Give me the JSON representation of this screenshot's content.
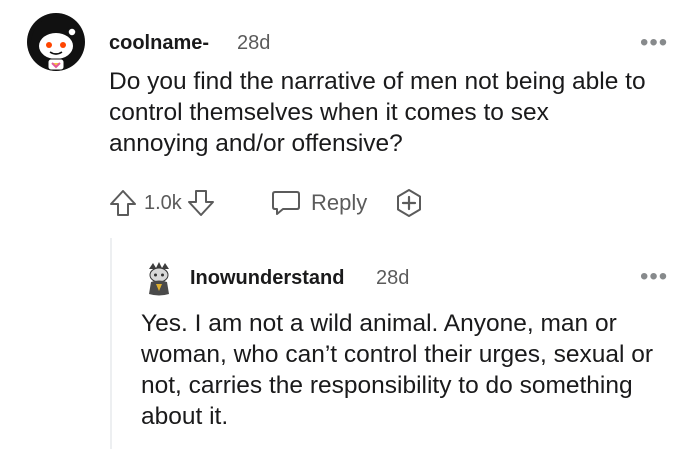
{
  "comment": {
    "username": "coolname-",
    "age": "28d",
    "text": "Do you find the narrative of men not being able to control themselves when it comes to sex annoying and/or offensive?",
    "score": "1.0k",
    "reply_label": "Reply"
  },
  "reply": {
    "username": "Inowunderstand",
    "age": "28d",
    "text": "Yes. I am not a wild animal. Anyone, man or woman, who can’t control their urges, sexual or not, carries the responsibility to do something about it."
  },
  "icons": {
    "more": "more-options-icon",
    "upvote": "upvote-arrow-icon",
    "downvote": "downvote-arrow-icon",
    "reply": "speech-bubble-icon",
    "award": "award-plus-icon"
  }
}
